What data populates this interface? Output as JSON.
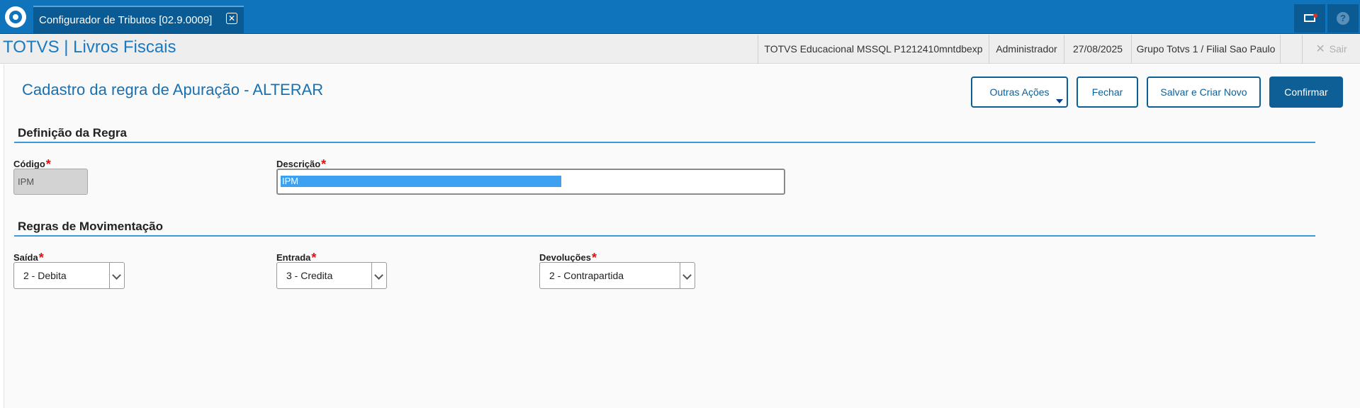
{
  "window": {
    "tab_title": "Configurador de Tributos [02.9.0009]",
    "tab_close_icon": "close-icon",
    "right_icons": [
      "mail-icon",
      "help-icon"
    ],
    "help_glyph": "?"
  },
  "header": {
    "app_title": "TOTVS | Livros Fiscais",
    "environment": "TOTVS Educacional MSSQL P1212410mntdbexp",
    "user": "Administrador",
    "date": "27/08/2025",
    "branch": "Grupo Totvs 1 / Filial Sao Paulo",
    "logout_label": "Sair"
  },
  "page": {
    "title": "Cadastro da regra de Apuração - ALTERAR",
    "actions": {
      "outras_acoes": "Outras Ações",
      "fechar": "Fechar",
      "salvar_criar": "Salvar e Criar Novo",
      "confirmar": "Confirmar"
    }
  },
  "section_regra": {
    "title": "Definição da Regra",
    "codigo_label": "Código",
    "codigo_value": "IPM",
    "descricao_label": "Descrição",
    "descricao_value": "IPM"
  },
  "section_mov": {
    "title": "Regras de Movimentação",
    "saida_label": "Saída",
    "saida_value": "2 - Debita",
    "entrada_label": "Entrada",
    "entrada_value": "3 - Credita",
    "devolucoes_label": "Devoluções",
    "devolucoes_value": "2 - Contrapartida"
  },
  "required_marker": "*",
  "colors": {
    "primary": "#0f74bb",
    "primary_dark": "#0a5a94",
    "title_blue": "#1a6fae",
    "section_line": "#3a9ae0",
    "required": "#e01010",
    "selection": "#3ea0f0"
  }
}
